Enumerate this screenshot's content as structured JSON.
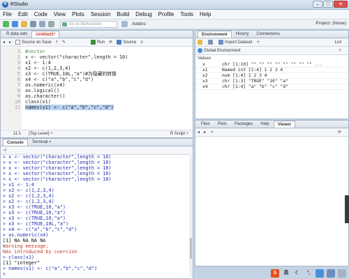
{
  "window": {
    "title": "RStudio",
    "logo_letter": "R",
    "minimize": "–",
    "maximize": "□",
    "close": "✕"
  },
  "menu": [
    "File",
    "Edit",
    "Code",
    "View",
    "Plots",
    "Session",
    "Build",
    "Debug",
    "Profile",
    "Tools",
    "Help"
  ],
  "toolbar": {
    "goto_placeholder": "Go to file/function",
    "addins": "Addins",
    "project": "Project: (None)"
  },
  "source": {
    "tabs": [
      "R data sets",
      "Untitled1*"
    ],
    "source_on_save": "Source on Save",
    "run": "Run",
    "source_btn": "Source",
    "lines": [
      {
        "n": "1",
        "t": "#vector"
      },
      {
        "n": "2",
        "t": "x <- vector(\"character\",length = 10)"
      },
      {
        "n": "3",
        "t": "x1 <- 1:4"
      },
      {
        "n": "4",
        "t": "x2 <- c(1,2,3,4)"
      },
      {
        "n": "5",
        "t": "x3 <- c(TRUE,10L,\"a\")#为隐藏的转换"
      },
      {
        "n": "6",
        "t": "x4 <- c(\"a\",\"b\",\"c\",\"d\")"
      },
      {
        "n": "7",
        "t": "as.numeric(x4)"
      },
      {
        "n": "8",
        "t": "as.logical()"
      },
      {
        "n": "9",
        "t": "as.character()"
      },
      {
        "n": "10",
        "t": "class(x1)"
      },
      {
        "n": "11",
        "t": "names(x1) <- c(\"a\",\"b\",\"c\",\"d\")"
      }
    ],
    "status_pos": "11:1",
    "status_scope": "(Top Level) ÷",
    "status_type": "R Script ÷"
  },
  "console": {
    "tabs": [
      "Console",
      "Terminal ×"
    ],
    "path": "~/",
    "lines": [
      {
        "k": "cmd",
        "t": "> x <- vector(\"character\",length = 10)"
      },
      {
        "k": "cmd",
        "t": "> x <- vector(\"character\",length = 10)"
      },
      {
        "k": "cmd",
        "t": "> x <- vector(\"character\",length = 10)"
      },
      {
        "k": "cmd",
        "t": "> x <- vector(\"character\",length = 10)"
      },
      {
        "k": "cmd",
        "t": "> x <- vector(\"character\",length = 10)"
      },
      {
        "k": "cmd",
        "t": "> x1 <- 1:4"
      },
      {
        "k": "cmd",
        "t": "> x2 <- c(1,2,3,4)"
      },
      {
        "k": "cmd",
        "t": "> x2 <- c(1,2,3,4)"
      },
      {
        "k": "cmd",
        "t": "> x2 <- c(1,2,3,4)"
      },
      {
        "k": "cmd",
        "t": "> x3 <- c(TRUE,10,\"a\")"
      },
      {
        "k": "cmd",
        "t": "> x3 <- c(TRUE,10,\"a\")"
      },
      {
        "k": "cmd",
        "t": "> x3 <- c(TRUE,10,\"a\")"
      },
      {
        "k": "cmd",
        "t": "> x3 <- c(TRUE,10L,\"a\")"
      },
      {
        "k": "cmd",
        "t": "> x4 <- c(\"a\",\"b\",\"c\",\"d\")"
      },
      {
        "k": "cmd",
        "t": "> as.numeric(x4)"
      },
      {
        "k": "out",
        "t": "[1] NA NA NA NA"
      },
      {
        "k": "err",
        "t": "Warning message:"
      },
      {
        "k": "err",
        "t": "NAs introduced by coercion"
      },
      {
        "k": "cmd",
        "t": "> class(x1)"
      },
      {
        "k": "out",
        "t": "[1] \"integer\""
      },
      {
        "k": "cmd",
        "t": "> names(x1) <- c(\"a\",\"b\",\"c\",\"d\")"
      },
      {
        "k": "cmd",
        "t": ">"
      }
    ]
  },
  "environment": {
    "tabs": [
      "Environment",
      "History",
      "Connections"
    ],
    "import_dataset": "Import Dataset",
    "global_env": "Global Environment",
    "list_view": "List",
    "header": "Values",
    "rows": [
      {
        "name": "x",
        "value": "chr [1:10] \"\" \"\" \"\" \"\" \"\" \"\" \"\" \"\" ..."
      },
      {
        "name": "x1",
        "value": "Named int [1:4] 1 2 3 4"
      },
      {
        "name": "x2",
        "value": "num [1:4] 1 2 3 4"
      },
      {
        "name": "x3",
        "value": "chr [1:3] \"TRUE\" \"10\" \"a\""
      },
      {
        "name": "x4",
        "value": "chr [1:4] \"a\" \"b\" \"c\" \"d\""
      }
    ]
  },
  "files": {
    "tabs": [
      "Files",
      "Plots",
      "Packages",
      "Help",
      "Viewer"
    ]
  },
  "tray": [
    "S",
    "英"
  ],
  "colors": {
    "accent": "#2a6bb5",
    "cmd": "#1f2fb0",
    "error": "#c0392b"
  }
}
